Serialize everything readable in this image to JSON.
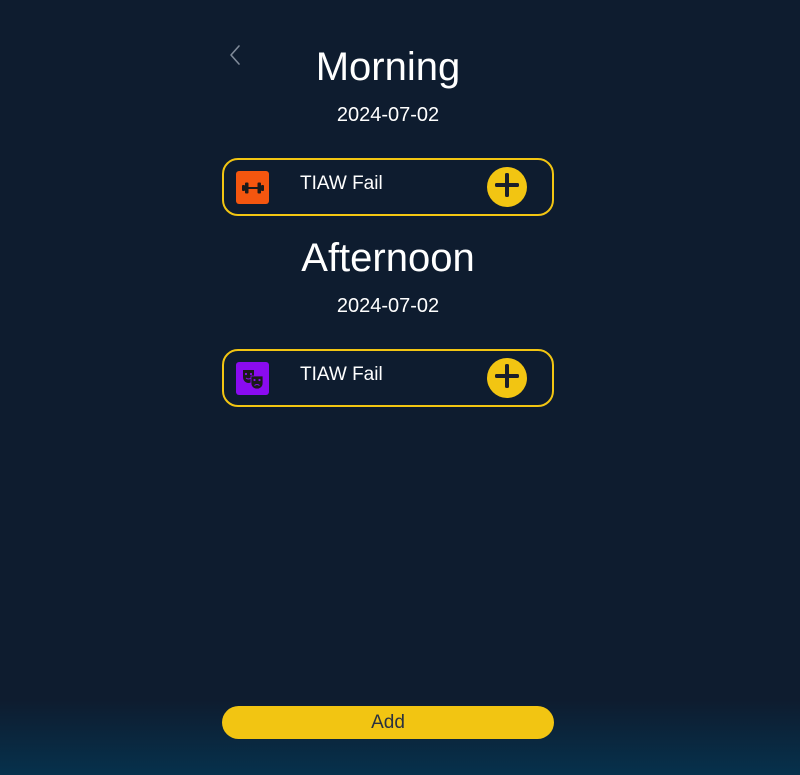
{
  "nav": {
    "back_icon": "chevron-left-icon"
  },
  "sections": [
    {
      "title": "Morning",
      "date": "2024-07-02",
      "task": {
        "label": "TIAW Fail",
        "icon": "dumbbell-icon",
        "icon_color": "#f4560f",
        "action_icon": "plus-circle-icon"
      }
    },
    {
      "title": "Afternoon",
      "date": "2024-07-02",
      "task": {
        "label": "TIAW Fail",
        "icon": "theater-masks-icon",
        "icon_color": "#8a0bf0",
        "action_icon": "plus-circle-icon"
      }
    }
  ],
  "footer": {
    "add_label": "Add"
  },
  "colors": {
    "background": "#0e1c2f",
    "accent": "#f2c512",
    "text": "#ffffff"
  }
}
